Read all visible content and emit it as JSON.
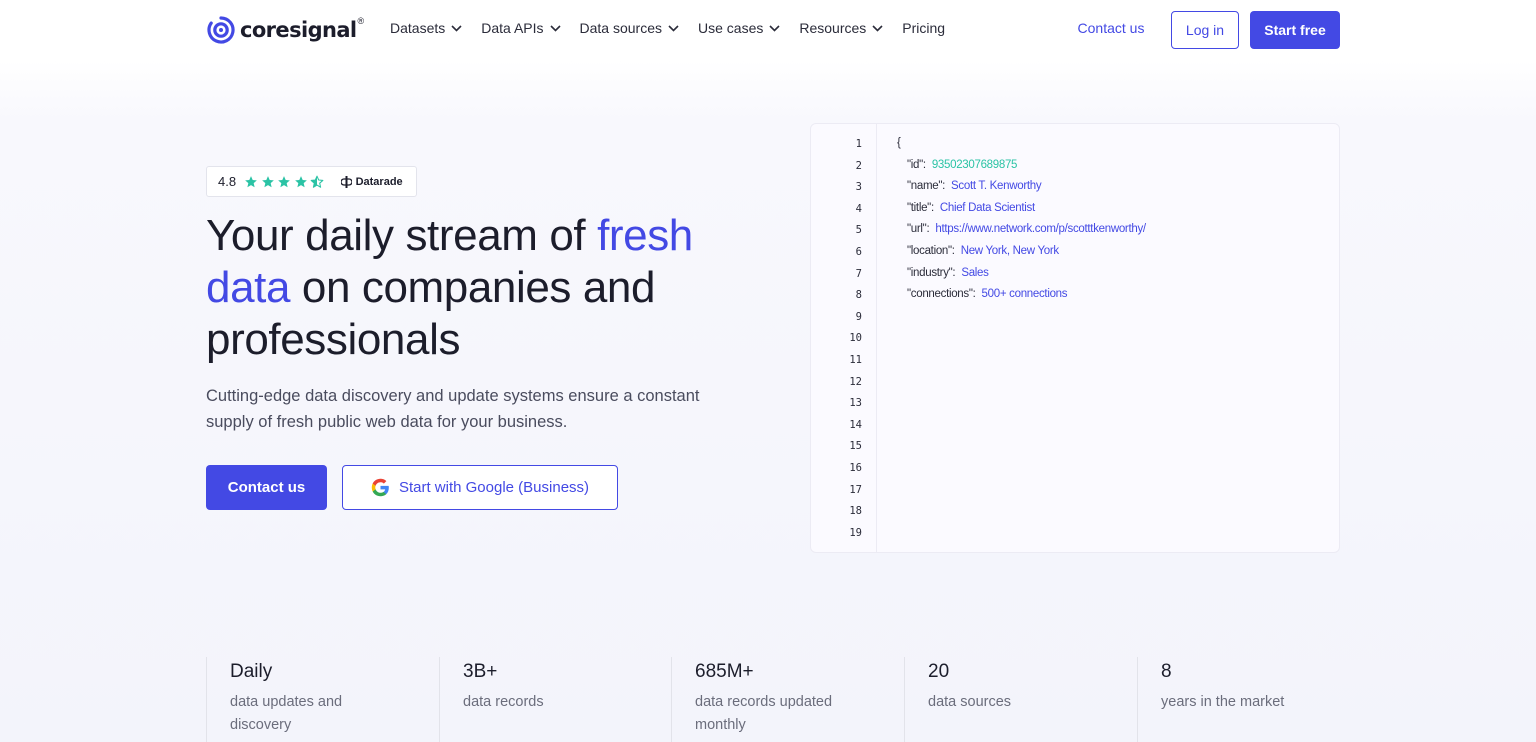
{
  "brand": {
    "name": "coresignal",
    "registered": "®",
    "accent_color": "#4349e4",
    "teal_color": "#2bc3a5"
  },
  "nav": {
    "menu": [
      {
        "label": "Datasets",
        "has_dropdown": true
      },
      {
        "label": "Data APIs",
        "has_dropdown": true
      },
      {
        "label": "Data sources",
        "has_dropdown": true
      },
      {
        "label": "Use cases",
        "has_dropdown": true
      },
      {
        "label": "Resources",
        "has_dropdown": true
      },
      {
        "label": "Pricing",
        "has_dropdown": false
      }
    ],
    "contact_label": "Contact us",
    "login_label": "Log in",
    "start_label": "Start free"
  },
  "rating": {
    "score": "4.8",
    "stars": 4.5,
    "source": "Datarade"
  },
  "hero": {
    "title_part1": "Your daily stream of ",
    "title_accent": "fresh data",
    "title_part2": " on companies and professionals",
    "subtitle": "Cutting-edge data discovery and update systems ensure a constant supply of fresh public web data for your business.",
    "contact_button": "Contact us",
    "google_button": "Start with Google (Business)"
  },
  "code_panel": {
    "line_numbers": [
      "1",
      "2",
      "3",
      "4",
      "5",
      "6",
      "7",
      "8",
      "9",
      "10",
      "11",
      "12",
      "13",
      "14",
      "15",
      "16",
      "17",
      "18",
      "19"
    ],
    "open_brace": "{",
    "fields": [
      {
        "key": "\"id\":",
        "value": "93502307689875",
        "numeric": true
      },
      {
        "key": "\"name\":",
        "value": "Scott T. Kenworthy",
        "numeric": false
      },
      {
        "key": "\"title\":",
        "value": "Chief Data Scientist",
        "numeric": false
      },
      {
        "key": "\"url\":",
        "value": "https://www.network.com/p/scotttkenworthy/",
        "numeric": false
      },
      {
        "key": "\"location\":",
        "value": "New York, New York",
        "numeric": false
      },
      {
        "key": "\"industry\":",
        "value": "Sales",
        "numeric": false
      },
      {
        "key": "\"connections\":",
        "value": "500+ connections",
        "numeric": false
      }
    ]
  },
  "stats": [
    {
      "value": "Daily",
      "label": "data updates and discovery"
    },
    {
      "value": "3B+",
      "label": "data records"
    },
    {
      "value": "685M+",
      "label": "data records updated monthly"
    },
    {
      "value": "20",
      "label": "data sources"
    },
    {
      "value": "8",
      "label": "years in the market"
    }
  ]
}
